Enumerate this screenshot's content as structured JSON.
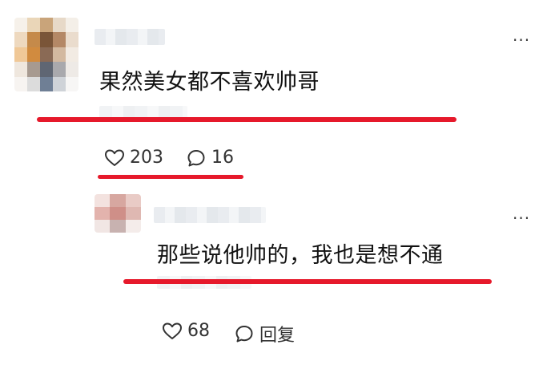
{
  "comments": [
    {
      "text": "果然美女都不喜欢帅哥",
      "likes": "203",
      "replies_count": "16",
      "avatar_colors": [
        "#f6f1ea",
        "#ead6b8",
        "#c9a47a",
        "#e7d9c8",
        "#f4efe8",
        "#eed9bf",
        "#c58a4a",
        "#7a5538",
        "#b48866",
        "#eadccd",
        "#f0c897",
        "#d18b3f",
        "#8a6a55",
        "#d3b9a0",
        "#f2ebe3",
        "#efe7de",
        "#a79a90",
        "#5f6673",
        "#a9a9ad",
        "#eeeae6",
        "#f7f4f1",
        "#dcdcdc",
        "#6f7f95",
        "#cfd3d8",
        "#f7f6f5"
      ]
    },
    {
      "text": "那些说他帅的，我也是想不通",
      "likes": "68",
      "reply_label": "回复",
      "avatar_colors": [
        "#f3e2df",
        "#d7a7a0",
        "#e9cbc6",
        "#e3b3ad",
        "#cf8f88",
        "#dfb8b2",
        "#f1e6e4",
        "#c8b2b0",
        "#f4ecea"
      ]
    }
  ],
  "colors": {
    "underline_red": "#e6192b",
    "icon_stroke": "#333333"
  },
  "icons": {
    "like": "heart-outline-icon",
    "comment": "speech-bubble-icon",
    "more": "more-dots-icon"
  }
}
